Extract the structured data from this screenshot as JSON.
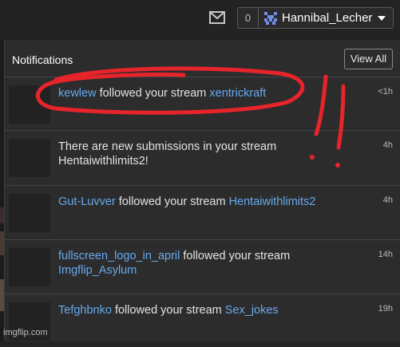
{
  "topbar": {
    "mail_icon": "mail-icon",
    "notification_count": "0",
    "username": "Hannibal_Lecher",
    "avatar_icon": "pixel-avatar-icon",
    "dropdown_icon": "caret-down-icon"
  },
  "panel": {
    "title": "Notifications",
    "view_all_label": "View All"
  },
  "notifications": [
    {
      "segments": [
        {
          "text": "kewlew",
          "link": true
        },
        {
          "text": " followed your stream ",
          "link": false
        },
        {
          "text": "xentrickraft",
          "link": true
        }
      ],
      "time": "<1h"
    },
    {
      "segments": [
        {
          "text": "There are new submissions in your stream Hentaiwithlimits2!",
          "link": false
        }
      ],
      "time": "4h"
    },
    {
      "segments": [
        {
          "text": "Gut-Luvver",
          "link": true
        },
        {
          "text": " followed your stream ",
          "link": false
        },
        {
          "text": "Hentaiwithlimits2",
          "link": true
        }
      ],
      "time": "4h"
    },
    {
      "segments": [
        {
          "text": "fullscreen_logo_in_april",
          "link": true
        },
        {
          "text": " followed your stream ",
          "link": false
        },
        {
          "text": "Imgflip_Asylum",
          "link": true
        }
      ],
      "time": "14h"
    },
    {
      "segments": [
        {
          "text": "Tefghbnko",
          "link": true
        },
        {
          "text": " followed your stream ",
          "link": false
        },
        {
          "text": "Sex_jokes",
          "link": true
        }
      ],
      "time": "19h"
    }
  ],
  "watermark": "imgflip.com",
  "colors": {
    "link": "#66aaee",
    "annotation": "#e8242b",
    "background": "#2c2c2c"
  }
}
